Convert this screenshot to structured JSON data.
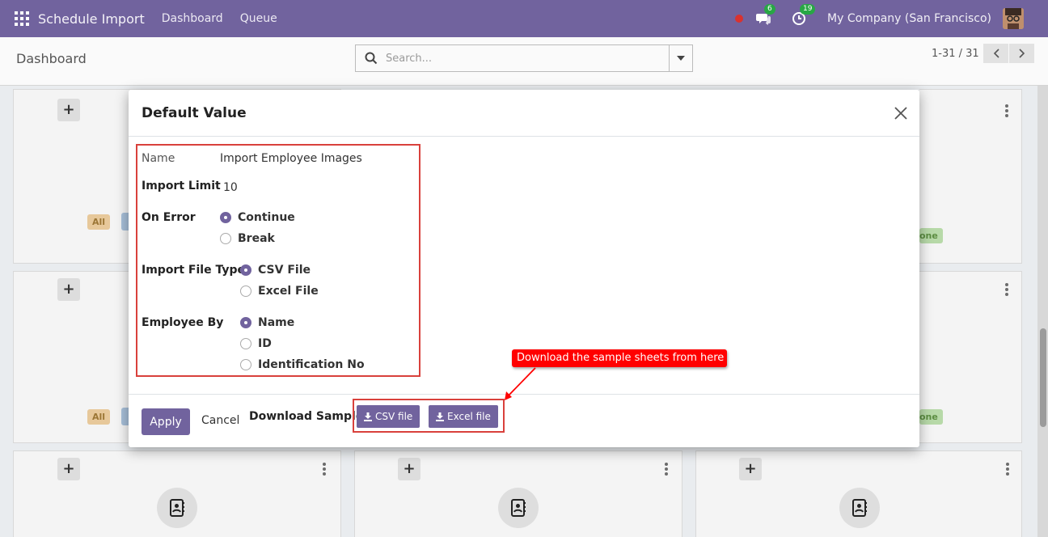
{
  "navbar": {
    "app_title": "Schedule Import",
    "links": [
      "Dashboard",
      "Queue"
    ],
    "chat_badge": "6",
    "activity_badge": "19",
    "company": "My Company (San Francisco)"
  },
  "control_panel": {
    "breadcrumb": "Dashboard",
    "search_placeholder": "Search...",
    "pager": "1-31 / 31"
  },
  "kanban": {
    "tag_all": "All",
    "tag_done": "one"
  },
  "modal": {
    "title": "Default Value",
    "fields": {
      "name_label": "Name",
      "name_value": "Import Employee Images",
      "import_limit_label": "Import Limit",
      "import_limit_value": "10",
      "on_error_label": "On Error",
      "on_error_options": [
        "Continue",
        "Break"
      ],
      "on_error_selected": "Continue",
      "file_type_label": "Import File Type",
      "file_type_options": [
        "CSV File",
        "Excel File"
      ],
      "file_type_selected": "CSV File",
      "employee_by_label": "Employee By",
      "employee_by_options": [
        "Name",
        "ID",
        "Identification No"
      ],
      "employee_by_selected": "Name"
    },
    "footer": {
      "apply_label": "Apply",
      "cancel_label": "Cancel",
      "download_label": "Download Sample:",
      "csv_button": "CSV file",
      "excel_button": "Excel file"
    }
  },
  "annotation": {
    "callout_text": "Download the sample sheets from here"
  },
  "colors": {
    "brand": "#71639e",
    "highlight": "#d9413c",
    "callout": "#ff0000"
  }
}
